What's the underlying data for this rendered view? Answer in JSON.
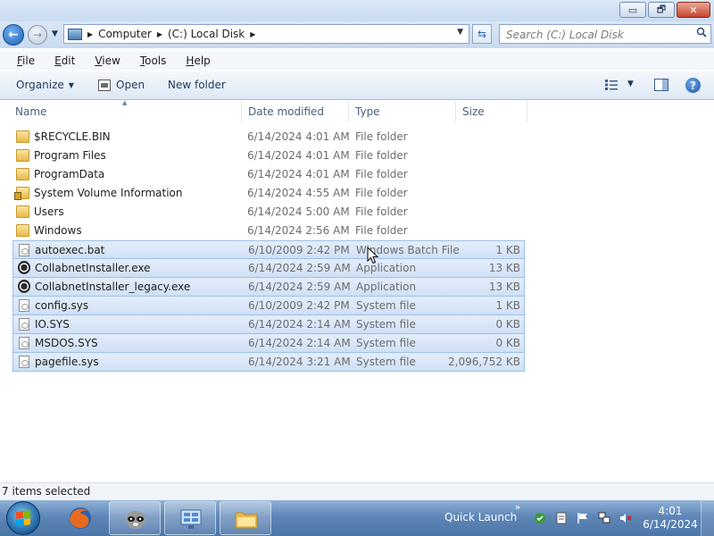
{
  "titlebar": {
    "minimize": "▭",
    "maximize": "🗗",
    "close": "✕"
  },
  "address": {
    "crumbs": [
      "Computer",
      "(C:) Local Disk"
    ]
  },
  "search": {
    "placeholder": "Search (C:) Local Disk"
  },
  "menu": {
    "items": [
      "File",
      "Edit",
      "View",
      "Tools",
      "Help"
    ],
    "accelerators": [
      "F",
      "E",
      "V",
      "T",
      "H"
    ]
  },
  "commands": {
    "organize": "Organize",
    "open": "Open",
    "new_folder": "New folder"
  },
  "columns": {
    "name": "Name",
    "date": "Date modified",
    "type": "Type",
    "size": "Size"
  },
  "files": [
    {
      "name": "$RECYCLE.BIN",
      "date": "6/14/2024 4:01 AM",
      "type": "File folder",
      "size": "",
      "icon": "folder-icon",
      "selected": false
    },
    {
      "name": "Program Files",
      "date": "6/14/2024 4:01 AM",
      "type": "File folder",
      "size": "",
      "icon": "folder-icon",
      "selected": false
    },
    {
      "name": "ProgramData",
      "date": "6/14/2024 4:01 AM",
      "type": "File folder",
      "size": "",
      "icon": "folder-icon",
      "selected": false
    },
    {
      "name": "System Volume Information",
      "date": "6/14/2024 4:55 AM",
      "type": "File folder",
      "size": "",
      "icon": "locked-folder-icon",
      "selected": false
    },
    {
      "name": "Users",
      "date": "6/14/2024 5:00 AM",
      "type": "File folder",
      "size": "",
      "icon": "folder-icon",
      "selected": false
    },
    {
      "name": "Windows",
      "date": "6/14/2024 2:56 AM",
      "type": "File folder",
      "size": "",
      "icon": "folder-icon",
      "selected": false
    },
    {
      "name": "autoexec.bat",
      "date": "6/10/2009 2:42 PM",
      "type": "Windows Batch File",
      "size": "1 KB",
      "icon": "document-icon",
      "selected": true
    },
    {
      "name": "CollabnetInstaller.exe",
      "date": "6/14/2024 2:59 AM",
      "type": "Application",
      "size": "13 KB",
      "icon": "application-icon",
      "selected": true
    },
    {
      "name": "CollabnetInstaller_legacy.exe",
      "date": "6/14/2024 2:59 AM",
      "type": "Application",
      "size": "13 KB",
      "icon": "application-icon",
      "selected": true
    },
    {
      "name": "config.sys",
      "date": "6/10/2009 2:42 PM",
      "type": "System file",
      "size": "1 KB",
      "icon": "document-icon",
      "selected": true
    },
    {
      "name": "IO.SYS",
      "date": "6/14/2024 2:14 AM",
      "type": "System file",
      "size": "0 KB",
      "icon": "document-icon",
      "selected": true
    },
    {
      "name": "MSDOS.SYS",
      "date": "6/14/2024 2:14 AM",
      "type": "System file",
      "size": "0 KB",
      "icon": "document-icon",
      "selected": true
    },
    {
      "name": "pagefile.sys",
      "date": "6/14/2024 3:21 AM",
      "type": "System file",
      "size": "2,096,752 KB",
      "icon": "document-icon",
      "selected": true
    }
  ],
  "status": {
    "text": "7 items selected"
  },
  "taskbar": {
    "quick_launch": "Quick Launch",
    "chevron": "»",
    "time": "4:01",
    "date": "6/14/2024"
  },
  "colors": {
    "selection": "#cfe0f6",
    "selection_border": "#9cc0e8",
    "taskbar": "#5e86b7"
  }
}
